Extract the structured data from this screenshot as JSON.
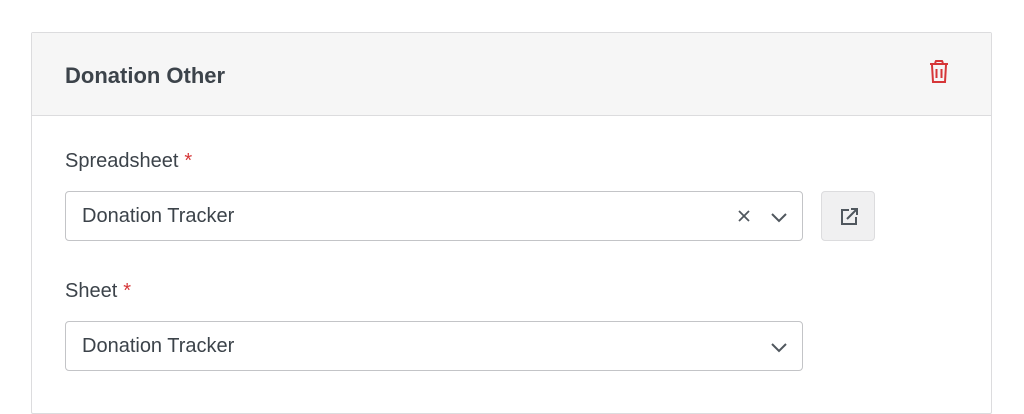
{
  "card": {
    "title": "Donation Other"
  },
  "fields": {
    "spreadsheet": {
      "label": "Spreadsheet",
      "required_mark": "*",
      "value": "Donation Tracker"
    },
    "sheet": {
      "label": "Sheet",
      "required_mark": "*",
      "value": "Donation Tracker"
    }
  },
  "icons": {
    "delete": "trash-icon",
    "clear": "close-icon",
    "dropdown": "chevron-down-icon",
    "open_external": "external-link-icon"
  },
  "colors": {
    "required": "#d63638",
    "delete_icon": "#d63638",
    "header_bg": "#f6f6f6",
    "border": "#dcdcde"
  }
}
